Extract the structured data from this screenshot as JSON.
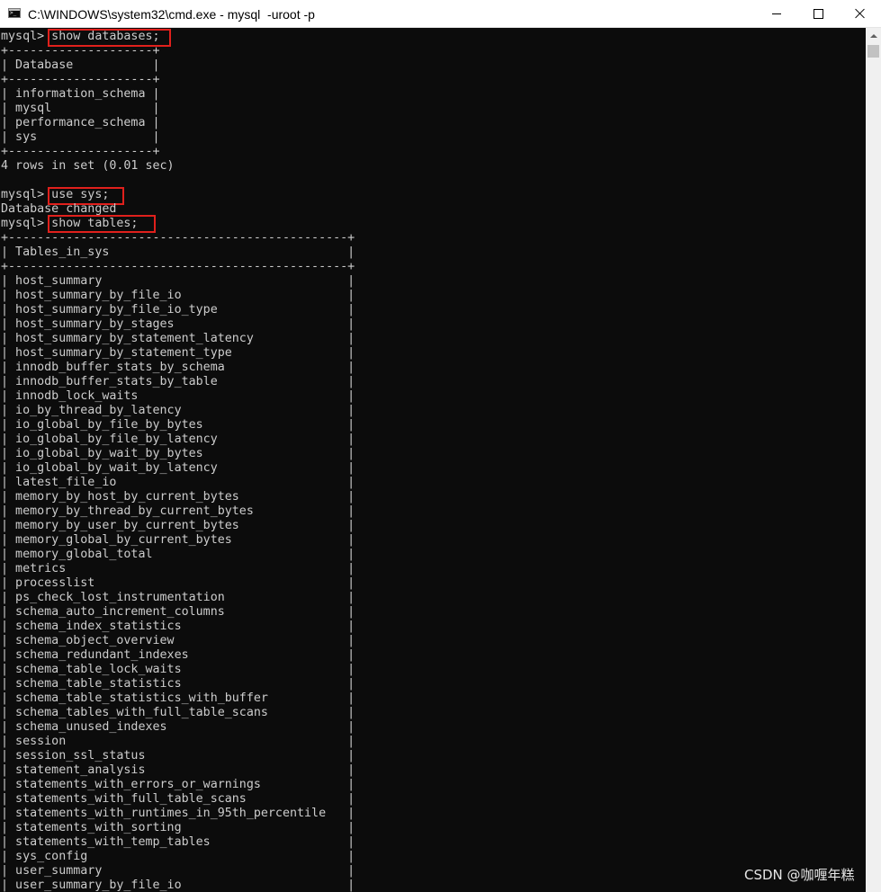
{
  "window": {
    "title": "C:\\WINDOWS\\system32\\cmd.exe - mysql  -uroot -p"
  },
  "icons": {
    "app": "console-window-icon",
    "minimize": "minimize-icon",
    "maximize": "maximize-icon",
    "close": "close-icon",
    "scroll_up": "arrow-up-icon"
  },
  "colors": {
    "console_bg": "#0c0c0c",
    "console_text": "#cccccc",
    "highlight_box": "#e0201c"
  },
  "console": {
    "lines": [
      "mysql> show databases;",
      "+--------------------+",
      "| Database           |",
      "+--------------------+",
      "| information_schema |",
      "| mysql              |",
      "| performance_schema |",
      "| sys                |",
      "+--------------------+",
      "4 rows in set (0.01 sec)",
      "",
      "mysql> use sys;",
      "Database changed",
      "mysql> show tables;",
      "+-----------------------------------------------+",
      "| Tables_in_sys                                 |",
      "+-----------------------------------------------+",
      "| host_summary                                  |",
      "| host_summary_by_file_io                       |",
      "| host_summary_by_file_io_type                  |",
      "| host_summary_by_stages                        |",
      "| host_summary_by_statement_latency             |",
      "| host_summary_by_statement_type                |",
      "| innodb_buffer_stats_by_schema                 |",
      "| innodb_buffer_stats_by_table                  |",
      "| innodb_lock_waits                             |",
      "| io_by_thread_by_latency                       |",
      "| io_global_by_file_by_bytes                    |",
      "| io_global_by_file_by_latency                  |",
      "| io_global_by_wait_by_bytes                    |",
      "| io_global_by_wait_by_latency                  |",
      "| latest_file_io                                |",
      "| memory_by_host_by_current_bytes               |",
      "| memory_by_thread_by_current_bytes             |",
      "| memory_by_user_by_current_bytes               |",
      "| memory_global_by_current_bytes                |",
      "| memory_global_total                           |",
      "| metrics                                       |",
      "| processlist                                   |",
      "| ps_check_lost_instrumentation                 |",
      "| schema_auto_increment_columns                 |",
      "| schema_index_statistics                       |",
      "| schema_object_overview                        |",
      "| schema_redundant_indexes                      |",
      "| schema_table_lock_waits                       |",
      "| schema_table_statistics                       |",
      "| schema_table_statistics_with_buffer           |",
      "| schema_tables_with_full_table_scans           |",
      "| schema_unused_indexes                         |",
      "| session                                       |",
      "| session_ssl_status                            |",
      "| statement_analysis                            |",
      "| statements_with_errors_or_warnings            |",
      "| statements_with_full_table_scans              |",
      "| statements_with_runtimes_in_95th_percentile   |",
      "| statements_with_sorting                       |",
      "| statements_with_temp_tables                   |",
      "| sys_config                                    |",
      "| user_summary                                  |",
      "| user_summary_by_file_io                       |"
    ]
  },
  "watermark": "CSDN @咖喱年糕"
}
